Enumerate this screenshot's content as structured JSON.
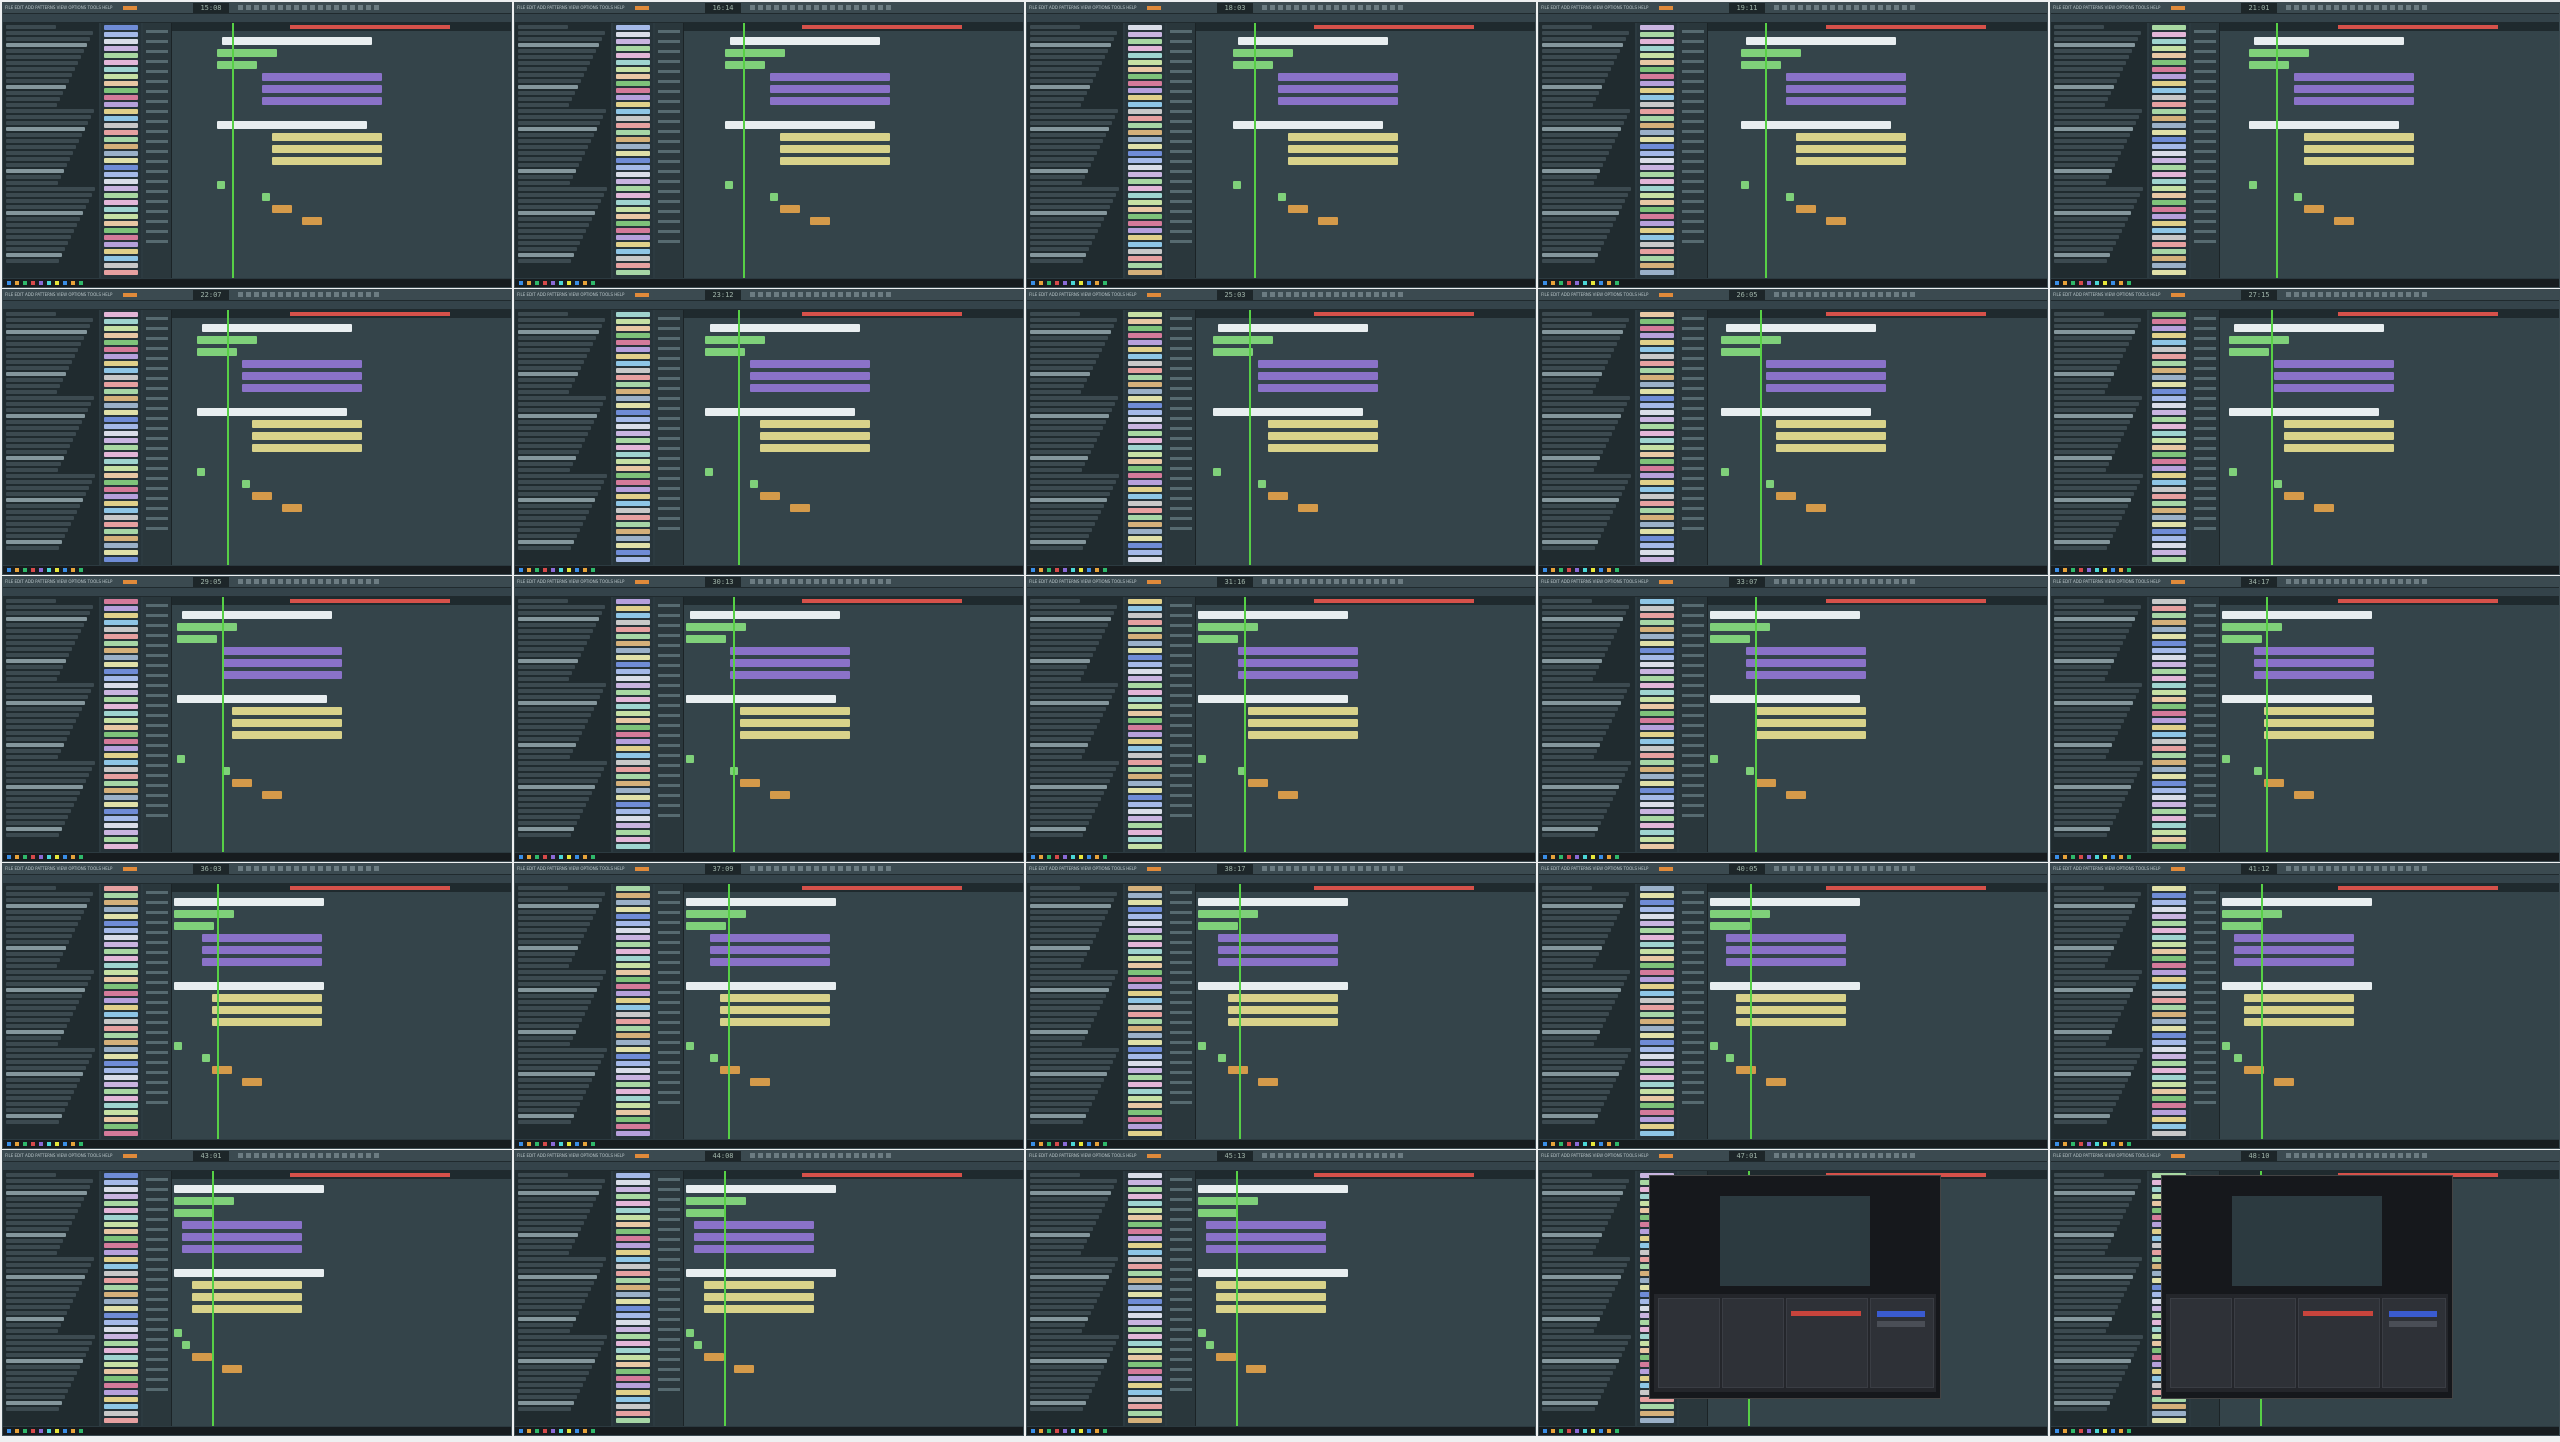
{
  "page": {
    "background": "#eef0f1"
  },
  "tiles": [
    {
      "id": "1",
      "time": "15:08"
    },
    {
      "id": "2",
      "time": "16:14"
    },
    {
      "id": "3",
      "time": "18:03"
    },
    {
      "id": "4",
      "time": "19:11"
    },
    {
      "id": "5",
      "time": "21:01"
    },
    {
      "id": "6",
      "time": "22:07"
    },
    {
      "id": "7",
      "time": "23:12"
    },
    {
      "id": "8",
      "time": "25:03"
    },
    {
      "id": "9",
      "time": "26:05"
    },
    {
      "id": "10",
      "time": "27:15"
    },
    {
      "id": "11",
      "time": "29:05"
    },
    {
      "id": "12",
      "time": "30:13"
    },
    {
      "id": "13",
      "time": "31:16"
    },
    {
      "id": "14",
      "time": "33:07"
    },
    {
      "id": "15",
      "time": "34:17"
    },
    {
      "id": "16",
      "time": "36:03"
    },
    {
      "id": "17",
      "time": "37:09"
    },
    {
      "id": "18",
      "time": "38:17"
    },
    {
      "id": "19",
      "time": "40:05"
    },
    {
      "id": "20",
      "time": "41:12"
    },
    {
      "id": "21",
      "time": "43:01"
    },
    {
      "id": "22",
      "time": "44:08"
    },
    {
      "id": "23",
      "time": "45:13"
    },
    {
      "id": "24",
      "time": "47:01",
      "obs": true
    },
    {
      "id": "25",
      "time": "48:10",
      "obs": true
    }
  ],
  "daw": {
    "menu_label": "FILE  EDIT  ADD  PATTERNS  VIEW  OPTIONS  TOOLS  HELP",
    "accent_playhead": "#57d046",
    "accent_marker": "#d6514a"
  }
}
